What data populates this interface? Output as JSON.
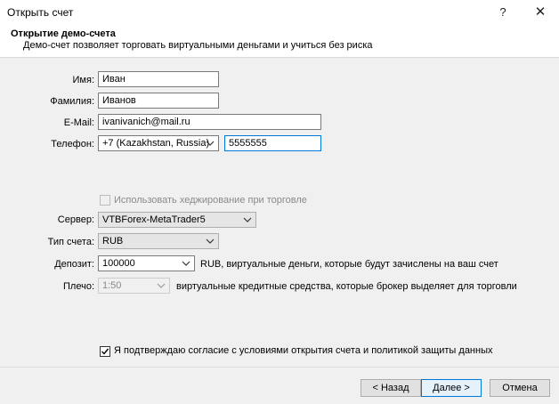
{
  "window": {
    "title": "Открыть счет",
    "help": "?",
    "close": "✕"
  },
  "header": {
    "title": "Открытие демо-счета",
    "subtitle": "Демо-счет позволяет торговать виртуальными деньгами и учиться без риска"
  },
  "form": {
    "name_label": "Имя:",
    "name_value": "Иван",
    "surname_label": "Фамилия:",
    "surname_value": "Иванов",
    "email_label": "E-Mail:",
    "email_value": "ivanivanich@mail.ru",
    "phone_label": "Телефон:",
    "phone_country": "+7 (Kazakhstan, Russia)",
    "phone_number": "5555555",
    "hedging_label": "Использовать хеджирование при торговле",
    "hedging_checked": false,
    "server_label": "Сервер:",
    "server_value": "VTBForex-MetaTrader5",
    "account_type_label": "Тип счета:",
    "account_type_value": "RUB",
    "deposit_label": "Депозит:",
    "deposit_value": "100000",
    "deposit_note": "RUB, виртуальные деньги, которые будут зачислены на ваш счет",
    "leverage_label": "Плечо:",
    "leverage_value": "1:50",
    "leverage_note": "виртуальные кредитные средства, которые брокер выделяет для торговли",
    "agree_label": "Я подтверждаю согласие с условиями открытия счета и политикой защиты данных",
    "agree_checked": true
  },
  "buttons": {
    "back": "< Назад",
    "next": "Далее >",
    "cancel": "Отмена"
  }
}
